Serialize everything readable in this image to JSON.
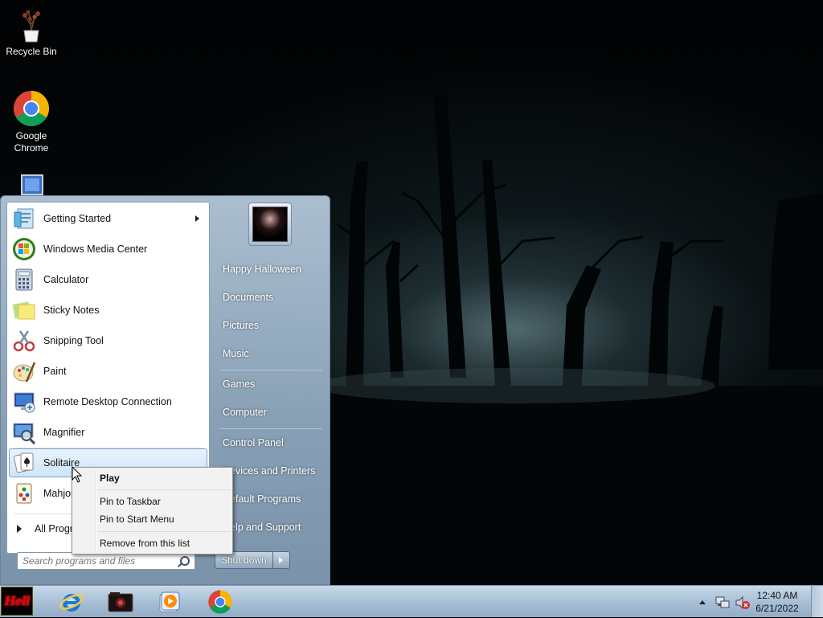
{
  "desktop": {
    "icons": [
      {
        "label": "Recycle Bin",
        "icon": "recycle-bin-icon"
      },
      {
        "label": "Google Chrome",
        "icon": "chrome-icon"
      },
      {
        "label": "",
        "icon": "computer-icon"
      }
    ]
  },
  "start_menu": {
    "programs": [
      {
        "label": "Getting Started",
        "icon": "getting-started-icon",
        "submenu": true
      },
      {
        "label": "Windows Media Center",
        "icon": "media-center-icon"
      },
      {
        "label": "Calculator",
        "icon": "calculator-icon"
      },
      {
        "label": "Sticky Notes",
        "icon": "sticky-notes-icon"
      },
      {
        "label": "Snipping Tool",
        "icon": "snipping-tool-icon"
      },
      {
        "label": "Paint",
        "icon": "paint-icon"
      },
      {
        "label": "Remote Desktop Connection",
        "icon": "remote-desktop-icon"
      },
      {
        "label": "Magnifier",
        "icon": "magnifier-icon"
      },
      {
        "label": "Solitaire",
        "icon": "solitaire-icon",
        "highlighted": true
      },
      {
        "label": "Mahjong Titans",
        "icon": "mahjong-icon"
      }
    ],
    "all_programs_label": "All Programs",
    "search_placeholder": "Search programs and files",
    "right_items": [
      {
        "label": "Happy Halloween"
      },
      {
        "label": "Documents"
      },
      {
        "label": "Pictures"
      },
      {
        "label": "Music"
      },
      {
        "label": "Games"
      },
      {
        "label": "Computer"
      },
      {
        "label": "Control Panel"
      },
      {
        "label": "Devices and Printers"
      },
      {
        "label": "Default Programs"
      },
      {
        "label": "Help and Support"
      }
    ],
    "shutdown_label": "Shut down"
  },
  "context_menu": {
    "items": [
      {
        "label": "Play",
        "bold": true
      },
      {
        "label": "Pin to Taskbar"
      },
      {
        "label": "Pin to Start Menu"
      },
      {
        "label": "Remove from this list"
      }
    ]
  },
  "taskbar": {
    "start_label": "Hell",
    "apps": [
      {
        "name": "internet-explorer-icon"
      },
      {
        "name": "explorer-folder-icon"
      },
      {
        "name": "media-player-icon"
      },
      {
        "name": "chrome-icon"
      }
    ],
    "clock": {
      "time": "12:40 AM",
      "date": "6/21/2022"
    }
  }
}
